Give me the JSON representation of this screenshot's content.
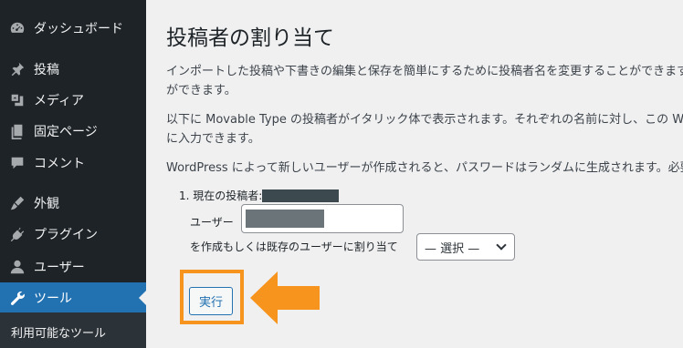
{
  "sidebar": {
    "items": [
      {
        "label": "ダッシュボード",
        "icon": "dashboard-icon"
      },
      {
        "label": "投稿",
        "icon": "pin-icon"
      },
      {
        "label": "メディア",
        "icon": "media-icon"
      },
      {
        "label": "固定ページ",
        "icon": "page-icon"
      },
      {
        "label": "コメント",
        "icon": "comment-icon"
      },
      {
        "label": "外観",
        "icon": "appearance-icon"
      },
      {
        "label": "プラグイン",
        "icon": "plugin-icon"
      },
      {
        "label": "ユーザー",
        "icon": "user-icon"
      },
      {
        "label": "ツール",
        "icon": "wrench-icon",
        "active": true
      }
    ],
    "submenu": {
      "label": "利用可能なツール"
    }
  },
  "main": {
    "title": "投稿者の割り当て",
    "paragraphs": [
      "インポートした投稿や下書きの編集と保存を簡単にするために投稿者名を変更することができます。",
      "ができます。",
      "以下に Movable Type の投稿者がイタリック体で表示されます。それぞれの名前に対し、この Wor",
      "に入力できます。",
      "WordPress によって新しいユーザーが作成されると、パスワードはランダムに生成されます。必要"
    ],
    "assign": {
      "current_author_label": "1. 現在の投稿者:",
      "user_label": "ユーザー",
      "create_or_assign_label": "を作成もしくは既存のユーザーに割り当て",
      "select_value": "— 選択 —"
    },
    "run_button": "実行"
  },
  "colors": {
    "sidebar_bg": "#1d2327",
    "active_bg": "#2271b1",
    "highlight": "#f7941d",
    "page_bg": "#f0f0f1"
  }
}
